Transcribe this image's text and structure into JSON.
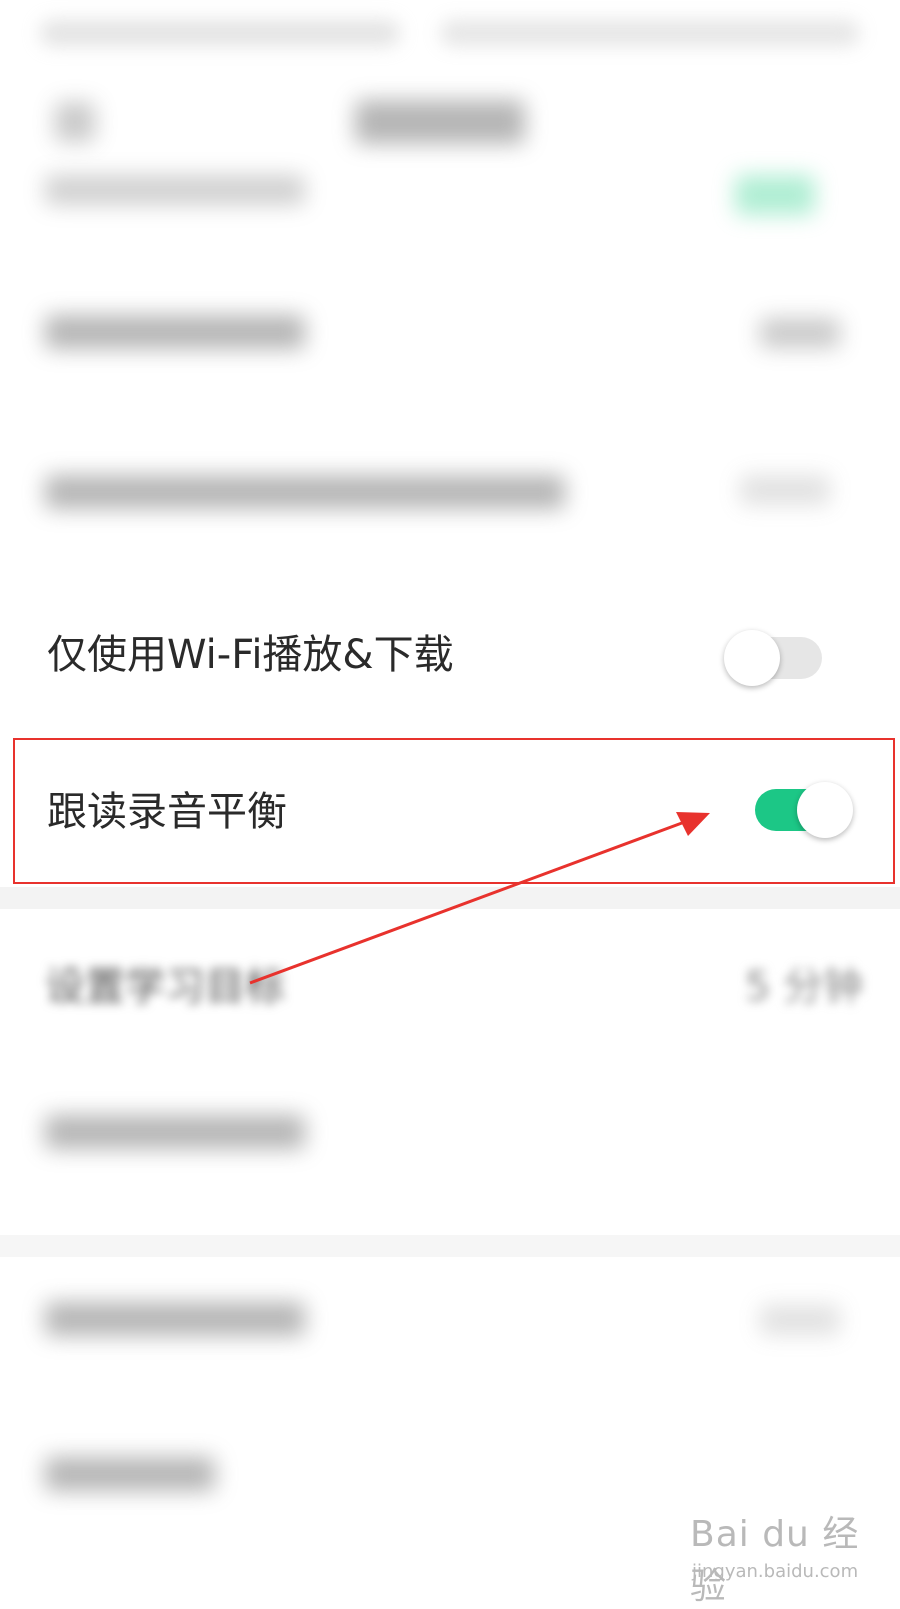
{
  "rows": {
    "wifi_only": {
      "label": "仅使用Wi-Fi播放&下载",
      "enabled": false
    },
    "follow_read_balance": {
      "label": "跟读录音平衡",
      "enabled": true
    },
    "study_goal": {
      "label": "设置学习目标",
      "value": "5 分钟"
    }
  },
  "watermark": {
    "logo": "Bai du 经验",
    "url": "jingyan.baidu.com"
  },
  "colors": {
    "toggle_on": "#1cc786",
    "toggle_off": "#e6e6e6",
    "highlight": "#e8322d"
  }
}
